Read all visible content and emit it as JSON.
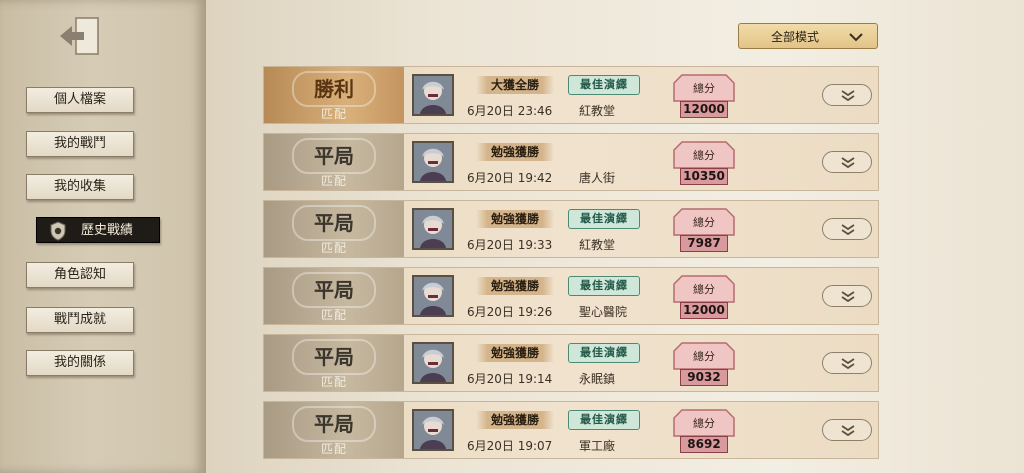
{
  "sidebar": {
    "items": [
      {
        "label": "個人檔案"
      },
      {
        "label": "我的戰鬥"
      },
      {
        "label": "我的收集"
      },
      {
        "label": "歷史戰績"
      },
      {
        "label": "角色認知"
      },
      {
        "label": "戰鬥成就"
      },
      {
        "label": "我的關係"
      }
    ]
  },
  "filter": {
    "mode_label": "全部模式"
  },
  "score_label": "總分",
  "matches": [
    {
      "result": "勝利",
      "mode": "匹配",
      "badge": "大獲全勝",
      "mvp": "最佳演繹",
      "date": "6月20日 23:46",
      "map": "紅教堂",
      "score": "12000"
    },
    {
      "result": "平局",
      "mode": "匹配",
      "badge": "勉強獲勝",
      "mvp": "",
      "date": "6月20日 19:42",
      "map": "唐人街",
      "score": "10350"
    },
    {
      "result": "平局",
      "mode": "匹配",
      "badge": "勉強獲勝",
      "mvp": "最佳演繹",
      "date": "6月20日 19:33",
      "map": "紅教堂",
      "score": "7987"
    },
    {
      "result": "平局",
      "mode": "匹配",
      "badge": "勉強獲勝",
      "mvp": "最佳演繹",
      "date": "6月20日 19:26",
      "map": "聖心醫院",
      "score": "12000"
    },
    {
      "result": "平局",
      "mode": "匹配",
      "badge": "勉強獲勝",
      "mvp": "最佳演繹",
      "date": "6月20日 19:14",
      "map": "永眠鎮",
      "score": "9032"
    },
    {
      "result": "平局",
      "mode": "匹配",
      "badge": "勉強獲勝",
      "mvp": "最佳演繹",
      "date": "6月20日 19:07",
      "map": "軍工廠",
      "score": "8692"
    }
  ]
}
